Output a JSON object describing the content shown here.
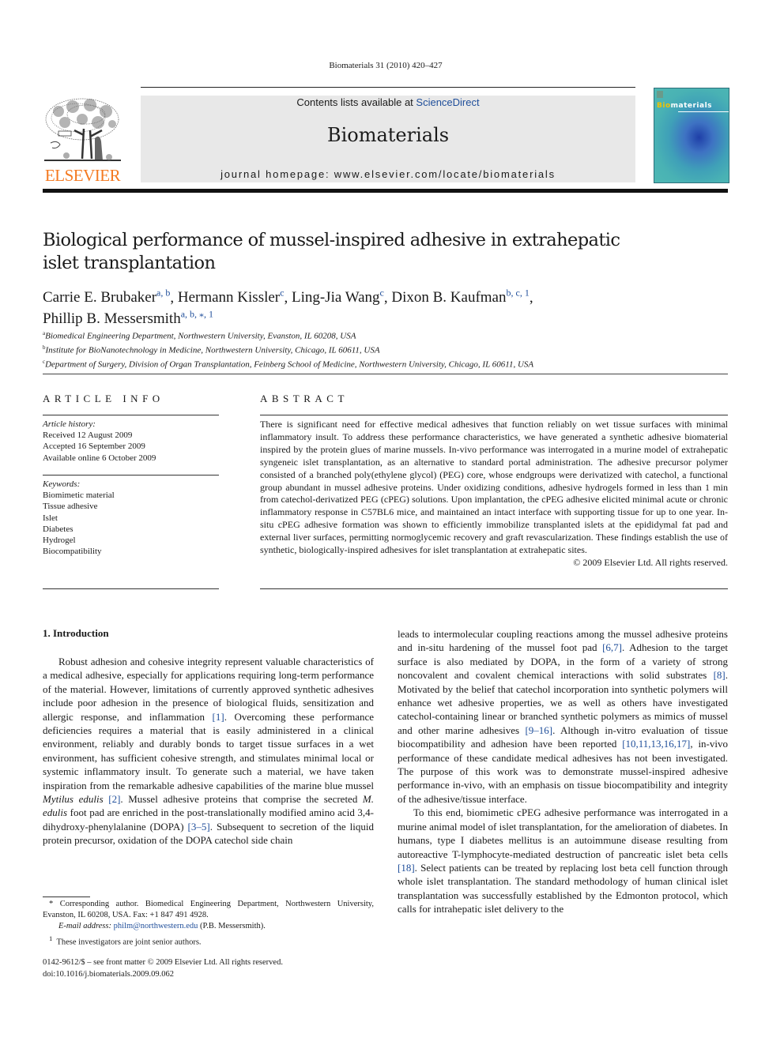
{
  "header": {
    "running_head": "Biomaterials 31 (2010) 420–427",
    "contents_prefix": "Contents lists available at ",
    "contents_link": "ScienceDirect",
    "journal_title": "Biomaterials",
    "homepage": "journal homepage: www.elsevier.com/locate/biomaterials",
    "publisher_logo_text": "ELSEVIER",
    "cover_title_highlight": "Bio",
    "cover_title_rest": "materials",
    "colors": {
      "elsevier_orange": "#f47920",
      "link_blue": "#1f4e9a",
      "banner_gray": "#e8e8e8"
    }
  },
  "article": {
    "title": "Biological performance of mussel-inspired adhesive in extrahepatic islet transplantation",
    "authors": [
      {
        "name": "Carrie E. Brubaker",
        "sup": "a, b",
        "sep": ", "
      },
      {
        "name": "Hermann Kissler",
        "sup": "c",
        "sep": ", "
      },
      {
        "name": "Ling-Jia Wang",
        "sup": "c",
        "sep": ", "
      },
      {
        "name": "Dixon B. Kaufman",
        "sup": "b, c, 1",
        "sep": ","
      },
      {
        "name": "Phillip B. Messersmith",
        "sup": "a, b, ⁎, 1",
        "sep": ""
      }
    ],
    "affiliations": [
      {
        "key": "a",
        "text": "Biomedical Engineering Department, Northwestern University, Evanston, IL 60208, USA"
      },
      {
        "key": "b",
        "text": "Institute for BioNanotechnology in Medicine, Northwestern University, Chicago, IL 60611, USA"
      },
      {
        "key": "c",
        "text": "Department of Surgery, Division of Organ Transplantation, Feinberg School of Medicine, Northwestern University, Chicago, IL 60611, USA"
      }
    ]
  },
  "article_info": {
    "heading": "ARTICLE INFO",
    "history_label": "Article history:",
    "history": [
      "Received 12 August 2009",
      "Accepted 16 September 2009",
      "Available online 6 October 2009"
    ],
    "keywords_label": "Keywords:",
    "keywords": [
      "Biomimetic material",
      "Tissue adhesive",
      "Islet",
      "Diabetes",
      "Hydrogel",
      "Biocompatibility"
    ]
  },
  "abstract": {
    "heading": "ABSTRACT",
    "text": "There is significant need for effective medical adhesives that function reliably on wet tissue surfaces with minimal inflammatory insult. To address these performance characteristics, we have generated a synthetic adhesive biomaterial inspired by the protein glues of marine mussels. In-vivo performance was interrogated in a murine model of extrahepatic syngeneic islet transplantation, as an alternative to standard portal administration. The adhesive precursor polymer consisted of a branched poly(ethylene glycol) (PEG) core, whose endgroups were derivatized with catechol, a functional group abundant in mussel adhesive proteins. Under oxidizing conditions, adhesive hydrogels formed in less than 1 min from catechol-derivatized PEG (cPEG) solutions. Upon implantation, the cPEG adhesive elicited minimal acute or chronic inflammatory response in C57BL6 mice, and maintained an intact interface with supporting tissue for up to one year. In-situ cPEG adhesive formation was shown to efficiently immobilize transplanted islets at the epididymal fat pad and external liver surfaces, permitting normoglycemic recovery and graft revascularization. These findings establish the use of synthetic, biologically-inspired adhesives for islet transplantation at extrahepatic sites.",
    "copyright": "© 2009 Elsevier Ltd. All rights reserved."
  },
  "introduction": {
    "heading": "1.  Introduction",
    "left_column": [
      {
        "t": "Robust adhesion and cohesive integrity represent valuable characteristics of a medical adhesive, especially for applications requiring long-term performance of the material. However, limitations of currently approved synthetic adhesives include poor adhesion in the presence of biological fluids, sensitization and allergic response, and inflammation "
      },
      {
        "c": "[1]"
      },
      {
        "t": ". Overcoming these performance deficiencies requires a material that is easily administered in a clinical environment, reliably and durably bonds to target tissue surfaces in a wet environment, has sufficient cohesive strength, and stimulates minimal local or systemic inflammatory insult. To generate such a material, we have taken inspiration from the remarkable adhesive capabilities of the marine blue mussel "
      },
      {
        "i": "Mytilus edulis"
      },
      {
        "t": " "
      },
      {
        "c": "[2]"
      },
      {
        "t": ". Mussel adhesive proteins that comprise the secreted "
      },
      {
        "i": "M. edulis"
      },
      {
        "t": " foot pad are enriched in the post-translationally modified amino acid 3,4-dihydroxy-phenylalanine (DOPA) "
      },
      {
        "c": "[3–5]"
      },
      {
        "t": ". Subsequent to secretion of the liquid protein precursor, oxidation of the DOPA catechol side chain"
      }
    ],
    "right_column_p1": [
      {
        "t": "leads to intermolecular coupling reactions among the mussel adhesive proteins and in-situ hardening of the mussel foot pad "
      },
      {
        "c": "[6,7]"
      },
      {
        "t": ". Adhesion to the target surface is also mediated by DOPA, in the form of a variety of strong noncovalent and covalent chemical interactions with solid substrates "
      },
      {
        "c": "[8]"
      },
      {
        "t": ". Motivated by the belief that catechol incorporation into synthetic polymers will enhance wet adhesive properties, we as well as others have investigated catechol-containing linear or branched synthetic polymers as mimics of mussel and other marine adhesives "
      },
      {
        "c": "[9–16]"
      },
      {
        "t": ". Although in-vitro evaluation of tissue biocompatibility and adhesion have been reported "
      },
      {
        "c": "[10,11,13,16,17]"
      },
      {
        "t": ", in-vivo performance of these candidate medical adhesives has not been investigated. The purpose of this work was to demonstrate mussel-inspired adhesive performance in-vivo, with an emphasis on tissue biocompatibility and integrity of the adhesive/tissue interface."
      }
    ],
    "right_column_p2": [
      {
        "t": "To this end, biomimetic cPEG adhesive performance was interrogated in a murine animal model of islet transplantation, for the amelioration of diabetes. In humans, type I diabetes mellitus is an autoimmune disease resulting from autoreactive T-lymphocyte-mediated destruction of pancreatic islet beta cells "
      },
      {
        "c": "[18]"
      },
      {
        "t": ". Select patients can be treated by replacing lost beta cell function through whole islet transplantation. The standard methodology of human clinical islet transplantation was successfully established by the Edmonton protocol, which calls for intrahepatic islet delivery to the"
      }
    ]
  },
  "footnotes": {
    "corresponding": "* Corresponding author. Biomedical Engineering Department, Northwestern University, Evanston, IL 60208, USA. Fax: +1 847 491 4928.",
    "email_label": "E-mail address: ",
    "email": "philm@northwestern.edu",
    "email_suffix": " (P.B. Messersmith).",
    "joint_marker": "1",
    "joint": "These investigators are joint senior authors."
  },
  "bottom_meta": {
    "issn_line": "0142-9612/$ – see front matter © 2009 Elsevier Ltd. All rights reserved.",
    "doi": "doi:10.1016/j.biomaterials.2009.09.062"
  }
}
